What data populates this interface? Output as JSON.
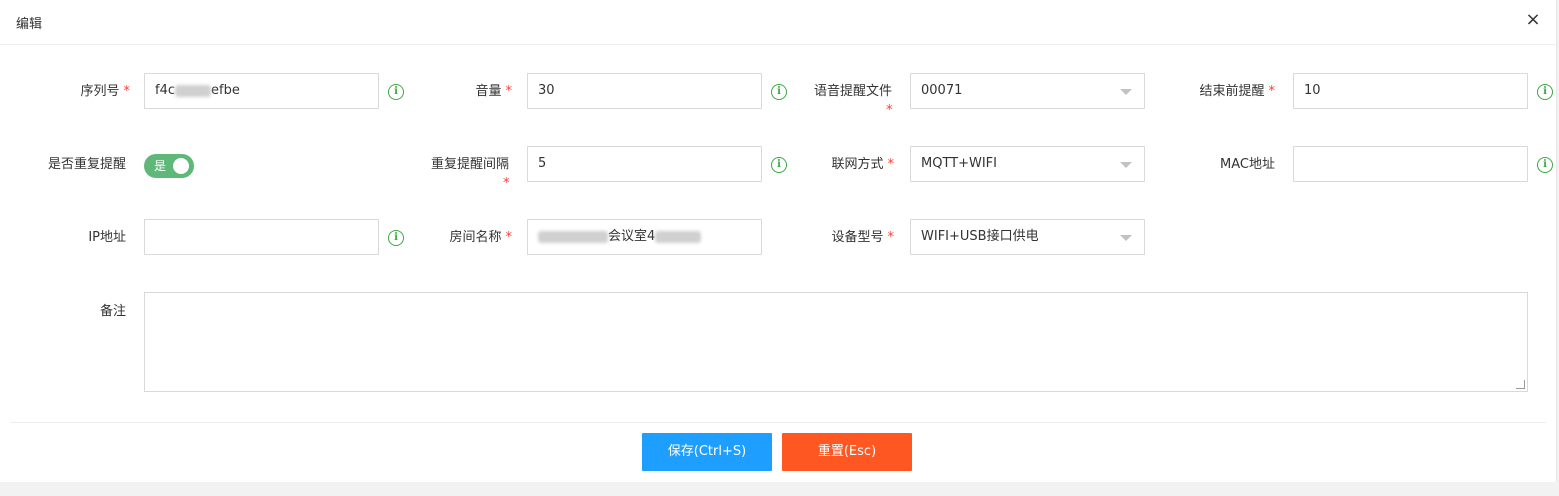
{
  "dialog": {
    "title": "编辑",
    "close_icon": "×"
  },
  "colors": {
    "required": "#ff3b30",
    "info": "#3aa844",
    "toggle_on": "#5fb878",
    "save_button": "#1e9fff",
    "reset_button": "#ff5722"
  },
  "required_mark": "*",
  "info_glyph": "i",
  "form": {
    "serial": {
      "label": "序列号",
      "value_start": "f4c",
      "value_end": "efbe"
    },
    "volume": {
      "label": "音量",
      "value": "30"
    },
    "voice_file": {
      "label": "语音提醒文件",
      "value": "00071"
    },
    "end_reminder": {
      "label": "结束前提醒",
      "value": "10"
    },
    "repeat_reminder": {
      "label": "是否重复提醒",
      "toggle_text": "是",
      "on": true
    },
    "repeat_interval": {
      "label": "重复提醒间隔",
      "value": "5"
    },
    "network_mode": {
      "label": "联网方式",
      "value": "MQTT+WIFI"
    },
    "mac": {
      "label": "MAC地址",
      "value": ""
    },
    "ip": {
      "label": "IP地址",
      "value": ""
    },
    "room_name": {
      "label": "房间名称",
      "value": "会议室4"
    },
    "device_model": {
      "label": "设备型号",
      "value": "WIFI+USB接口供电"
    },
    "remark": {
      "label": "备注",
      "value": ""
    }
  },
  "buttons": {
    "save": "保存(Ctrl+S)",
    "reset": "重置(Esc)"
  }
}
